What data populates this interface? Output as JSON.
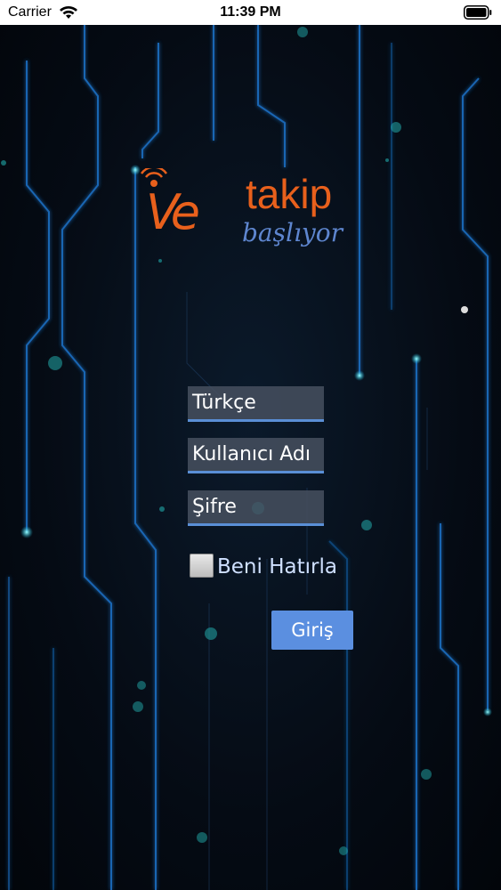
{
  "status_bar": {
    "carrier": "Carrier",
    "time": "11:39 PM"
  },
  "logo": {
    "mark": "Ve",
    "word": "takip",
    "tagline": "başlıyor"
  },
  "login_form": {
    "language": {
      "value": "Türkçe"
    },
    "username": {
      "placeholder": "Kullanıcı Adı"
    },
    "password": {
      "placeholder": "Şifre"
    },
    "remember": {
      "label": "Beni Hatırla",
      "checked": false
    },
    "submit_label": "Giriş"
  },
  "colors": {
    "brand_orange": "#e8601c",
    "accent_blue": "#5b8fe0",
    "tagline_blue": "#5e86cf",
    "glow_cyan": "#2ec8ff"
  }
}
